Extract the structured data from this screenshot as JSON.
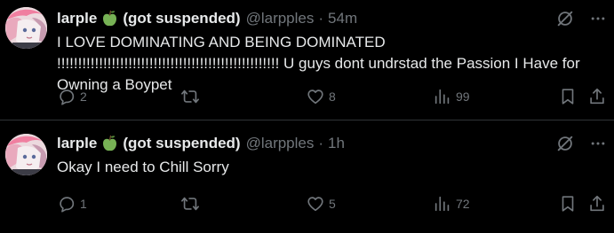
{
  "colors": {
    "background": "#000000",
    "text_primary": "#e7e9ea",
    "text_secondary": "#71767b",
    "divider": "#2f3336",
    "apple": "#77b255"
  },
  "tweets": [
    {
      "display_name": "larple",
      "name_emoji": "green-apple-icon",
      "name_suffix": "(got suspended)",
      "handle": "@larpples",
      "separator": "·",
      "time": "54m",
      "text": "I  LOVE DOMINATING AND BEING DOMINATED !!!!!!!!!!!!!!!!!!!!!!!!!!!!!!!!!!!!!!!!!!!!!!!!!!!!!  U guys dont undrstad the Passion I Have for Owning a Boypet",
      "replies": "2",
      "retweets": "",
      "likes": "8",
      "views": "99"
    },
    {
      "display_name": "larple",
      "name_emoji": "green-apple-icon",
      "name_suffix": "(got suspended)",
      "handle": "@larpples",
      "separator": "·",
      "time": "1h",
      "text": "Okay I need to Chill Sorry",
      "replies": "1",
      "retweets": "",
      "likes": "5",
      "views": "72"
    }
  ]
}
